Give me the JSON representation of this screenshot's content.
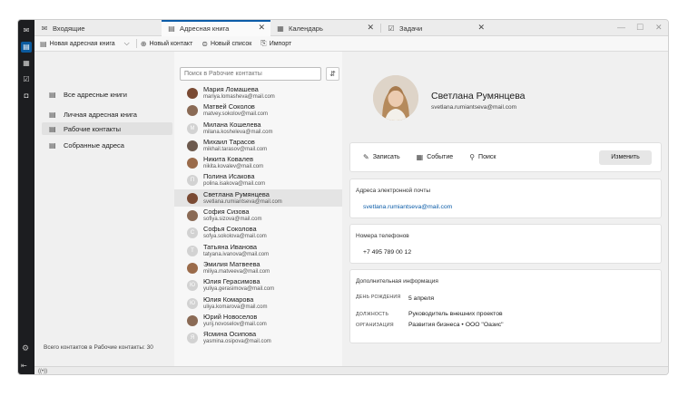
{
  "tabs": [
    {
      "label": "Входящие",
      "icon": "envelope-icon",
      "closable": false
    },
    {
      "label": "Адресная книга",
      "icon": "address-book-icon",
      "closable": true,
      "active": true
    },
    {
      "label": "Календарь",
      "icon": "calendar-icon",
      "closable": true
    },
    {
      "label": "Задачи",
      "icon": "tasks-icon",
      "closable": true
    }
  ],
  "toolbar": {
    "new_book": "Новая адресная книга",
    "new_contact": "Новый контакт",
    "new_list": "Новый список",
    "import": "Импорт"
  },
  "books": [
    {
      "label": "Все адресные книги"
    },
    {
      "label": "Личная адресная книга"
    },
    {
      "label": "Рабочие контакты",
      "active": true
    },
    {
      "label": "Собранные адреса"
    }
  ],
  "books_total": "Всего контактов в Рабочие контакты: 30",
  "search": {
    "placeholder": "Поиск в Рабочие контакты"
  },
  "contacts": [
    {
      "name": "Мария Ломашева",
      "email": "mariya.lomasheva@mail.com",
      "avatar": "photo"
    },
    {
      "name": "Матвей Соколов",
      "email": "matvey.sokolov@mail.com",
      "avatar": "photo"
    },
    {
      "name": "Милана Кошелева",
      "email": "milana.kosheleva@mail.com",
      "avatar": "М"
    },
    {
      "name": "Михаил Тарасов",
      "email": "mikhail.tarasov@mail.com",
      "avatar": "photo"
    },
    {
      "name": "Никита Ковалев",
      "email": "nikita.kovalev@mail.com",
      "avatar": "photo"
    },
    {
      "name": "Полина Исакова",
      "email": "polina.isakova@mail.com",
      "avatar": "П"
    },
    {
      "name": "Светлана Румянцева",
      "email": "svetlana.rumiantseva@mail.com",
      "avatar": "photo",
      "selected": true
    },
    {
      "name": "София Сизова",
      "email": "sofiya.sizova@mail.com",
      "avatar": "photo"
    },
    {
      "name": "Софья Соколова",
      "email": "sofya.sokolova@mail.com",
      "avatar": "С"
    },
    {
      "name": "Татьяна Иванова",
      "email": "tatyana.ivanova@mail.com",
      "avatar": "Т"
    },
    {
      "name": "Эмилия Матвеева",
      "email": "miliya.matveeva@mail.com",
      "avatar": "photo"
    },
    {
      "name": "Юлия Герасимова",
      "email": "yuliya.gerasimova@mail.com",
      "avatar": "Ю"
    },
    {
      "name": "Юлия Комарова",
      "email": "uliya.komarova@mail.com",
      "avatar": "Ю"
    },
    {
      "name": "Юрий Новоселов",
      "email": "yurij.novoselov@mail.com",
      "avatar": "photo"
    },
    {
      "name": "Ясмина Осипова",
      "email": "yasmina.osipova@mail.com",
      "avatar": "Я"
    }
  ],
  "detail": {
    "name": "Светлана Румянцева",
    "email": "svetlana.rumiantseva@mail.com",
    "actions": {
      "write": "Записать",
      "event": "Событие",
      "search": "Поиск",
      "edit": "Изменить"
    },
    "email_section_title": "Адреса электронной почты",
    "email_value": "svetlana.rumiantseva@mail.com",
    "phone_section_title": "Номера телефонов",
    "phone_value": "+7 495 789 00 12",
    "extra_title": "Дополнительная информация",
    "birthday_label": "ДЕНЬ РОЖДЕНИЯ",
    "birthday_value": "5 апреля",
    "position_label": "ДОЛЖНОСТЬ",
    "position_value": "Руководитель внешних проектов",
    "org_label": "ОРГАНИЗАЦИЯ",
    "org_value": "Развития бизнеса • ООО \"Оазис\""
  },
  "status": "((•))",
  "colors": {
    "accent": "#0b5ca8",
    "spaces_bar": "#1c1d20",
    "active_space": "#0b5a9e"
  }
}
